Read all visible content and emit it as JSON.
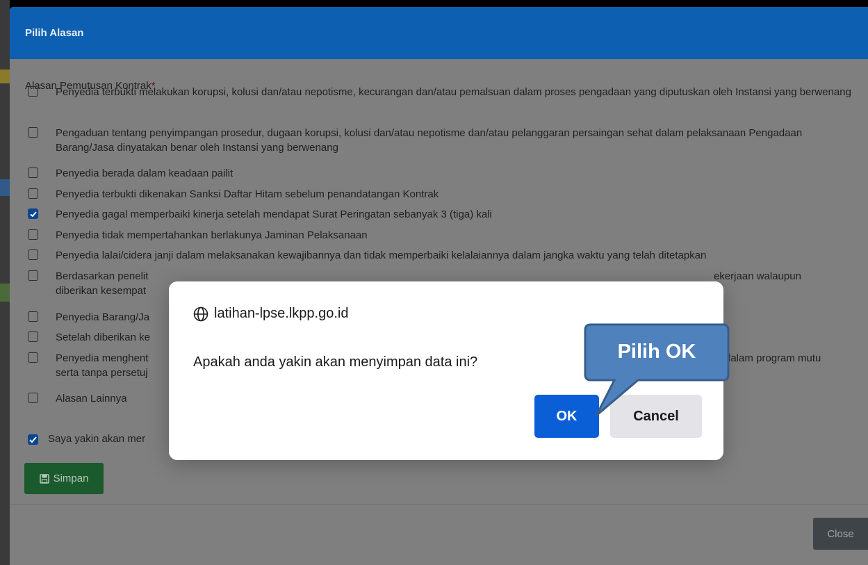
{
  "modal": {
    "title": "Pilih Alasan",
    "field_label": "Alasan Pemutusan Kontrak",
    "required_mark": "*",
    "reasons": [
      {
        "text": "Penyedia terbukti melakukan korupsi, kolusi dan/atau nepotisme, kecurangan dan/atau pemalsuan dalam proses pengadaan yang diputuskan oleh Instansi yang berwenang",
        "checked": false
      },
      {
        "text": "Pengaduan tentang penyimpangan prosedur, dugaan korupsi, kolusi dan/atau nepotisme dan/atau pelanggaran persaingan sehat dalam pelaksanaan Pengadaan Barang/Jasa dinyatakan benar oleh Instansi yang berwenang",
        "checked": false
      },
      {
        "text": "Penyedia berada dalam keadaan pailit",
        "checked": false
      },
      {
        "text": "Penyedia terbukti dikenakan Sanksi Daftar Hitam sebelum penandatangan Kontrak",
        "checked": false
      },
      {
        "text": "Penyedia gagal memperbaiki kinerja setelah mendapat Surat Peringatan sebanyak 3 (tiga) kali",
        "checked": true
      },
      {
        "text": "Penyedia tidak mempertahankan berlakunya Jaminan Pelaksanaan",
        "checked": false
      },
      {
        "text": "Penyedia lalai/cidera janji dalam melaksanakan kewajibannya dan tidak memperbaiki kelalaiannya dalam jangka waktu yang telah ditetapkan",
        "checked": false
      },
      {
        "text": "Berdasarkan penelit",
        "text_right": "ekerjaan walaupun",
        "text_line2": "diberikan kesempat",
        "checked": false
      },
      {
        "text": "Penyedia Barang/Ja",
        "checked": false
      },
      {
        "text": "Setelah diberikan ke",
        "checked": false
      },
      {
        "text": "Penyedia menghent",
        "text_right": "dalam program mutu",
        "text_line2": "serta tanpa persetuj",
        "checked": false
      },
      {
        "text": "Alasan Lainnya",
        "checked": false
      }
    ],
    "confirm_text": "Saya yakin akan mer",
    "confirm_checked": true,
    "save_label": "Simpan",
    "close_label": "Close"
  },
  "dialog": {
    "origin": "latihan-lpse.lkpp.go.id",
    "message": "Apakah anda yakin akan menyimpan data ini?",
    "ok_label": "OK",
    "cancel_label": "Cancel"
  },
  "callout": {
    "label": "Pilih OK"
  },
  "colors": {
    "header": "#0d5fb2",
    "ok_button": "#0b5fd6",
    "save_button": "#1a5a2c",
    "checkbox_checked": "#0a4690",
    "callout_fill": "#4f81bd",
    "callout_border": "#385d8a"
  },
  "icons": {
    "origin": "globe-icon",
    "save": "floppy-disk-icon",
    "checkbox": "check-icon"
  }
}
